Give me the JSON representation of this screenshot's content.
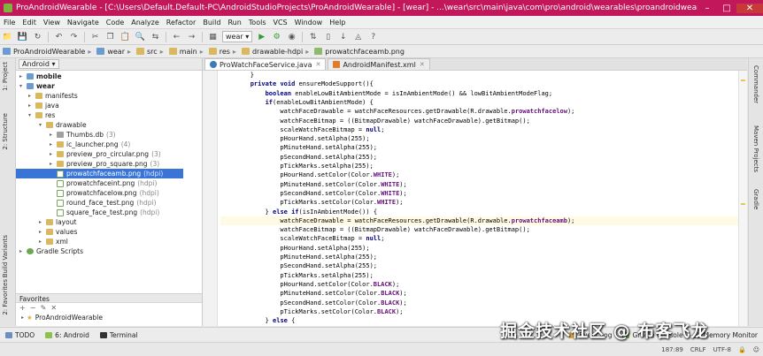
{
  "window": {
    "title": "ProAndroidWearable - [C:\\Users\\Default.Default-PC\\AndroidStudioProjects\\ProAndroidWearable] - [wear] - ...\\wear\\src\\main\\java\\com\\pro\\android\\wearables\\proandroidwearable\\ProWatchFa..."
  },
  "menu": [
    "File",
    "Edit",
    "View",
    "Navigate",
    "Code",
    "Analyze",
    "Refactor",
    "Build",
    "Run",
    "Tools",
    "VCS",
    "Window",
    "Help"
  ],
  "toolbar": {
    "run_config": "wear"
  },
  "breadcrumbs": [
    "ProAndroidWearable",
    "wear",
    "src",
    "main",
    "res",
    "drawable-hdpi",
    "prowatchfaceamb.png"
  ],
  "project": {
    "view_selector": "Android",
    "tree": [
      {
        "label": "mobile",
        "bold": true
      },
      {
        "label": "wear",
        "bold": true
      },
      {
        "label": "manifests"
      },
      {
        "label": "java"
      },
      {
        "label": "res"
      },
      {
        "label": "drawable"
      },
      {
        "label": "Thumbs.db",
        "suffix": "(3)"
      },
      {
        "label": "ic_launcher.png",
        "suffix": "(4)"
      },
      {
        "label": "preview_pro_circular.png",
        "suffix": "(3)"
      },
      {
        "label": "preview_pro_square.png",
        "suffix": "(3)"
      },
      {
        "label": "prowatchfaceamb.png",
        "suffix": "(hdpi)"
      },
      {
        "label": "prowatchfaceint.png",
        "suffix": "(hdpi)"
      },
      {
        "label": "prowatchfacelow.png",
        "suffix": "(hdpi)"
      },
      {
        "label": "round_face_test.png",
        "suffix": "(hdpi)"
      },
      {
        "label": "square_face_test.png",
        "suffix": "(hdpi)"
      },
      {
        "label": "layout"
      },
      {
        "label": "values"
      },
      {
        "label": "xml"
      },
      {
        "label": "Gradle Scripts"
      }
    ],
    "favorites_title": "Favorites",
    "favorites": [
      "ProAndroidWearable"
    ]
  },
  "left_tool_tabs": [
    "1: Project",
    "2: Structure",
    "Build Variants",
    "2: Favorites"
  ],
  "right_tool_tabs": [
    "Commander",
    "Maven Projects",
    "Gradle"
  ],
  "editor": {
    "tabs": [
      "ProWatchFaceService.java",
      "AndroidManifest.xml"
    ],
    "lines": [
      "        }",
      "        private void ensureModeSupport(){",
      "            boolean enableLowBitAmbientMode = isInAmbientMode() && lowBitAmbientModeFlag;",
      "            if(enableLowBitAmbientMode) {",
      "                watchFaceDrawable = watchFaceResources.getDrawable(R.drawable.prowatchfacelow);",
      "                watchFaceBitmap = ((BitmapDrawable) watchFaceDrawable).getBitmap();",
      "                scaleWatchFaceBitmap = null;",
      "                pHourHand.setAlpha(255);",
      "                pMinuteHand.setAlpha(255);",
      "                pSecondHand.setAlpha(255);",
      "                pTickMarks.setAlpha(255);",
      "                pHourHand.setColor(Color.WHITE);",
      "                pMinuteHand.setColor(Color.WHITE);",
      "                pSecondHand.setColor(Color.WHITE);",
      "                pTickMarks.setColor(Color.WHITE);",
      "            } else if(isInAmbientMode()) {",
      "                watchFaceDrawable = watchFaceResources.getDrawable(R.drawable.prowatchfaceamb);",
      "                watchFaceBitmap = ((BitmapDrawable) watchFaceDrawable).getBitmap();",
      "                scaleWatchFaceBitmap = null;",
      "                pHourHand.setAlpha(255);",
      "                pMinuteHand.setAlpha(255);",
      "                pSecondHand.setAlpha(255);",
      "                pTickMarks.setAlpha(255);",
      "                pHourHand.setColor(Color.BLACK);",
      "                pMinuteHand.setColor(Color.BLACK);",
      "                pSecondHand.setColor(Color.BLACK);",
      "                pTickMarks.setColor(Color.BLACK);",
      "            } else {"
    ]
  },
  "bottom_tabs": [
    "TODO",
    "6: Android",
    "Terminal",
    "Event Log",
    "Gradle Console",
    "Memory Monitor"
  ],
  "status": {
    "position": "187:89",
    "line_sep": "CRLF",
    "encoding": "UTF-8"
  },
  "watermark": "掘金技术社区 @ 布客飞龙"
}
